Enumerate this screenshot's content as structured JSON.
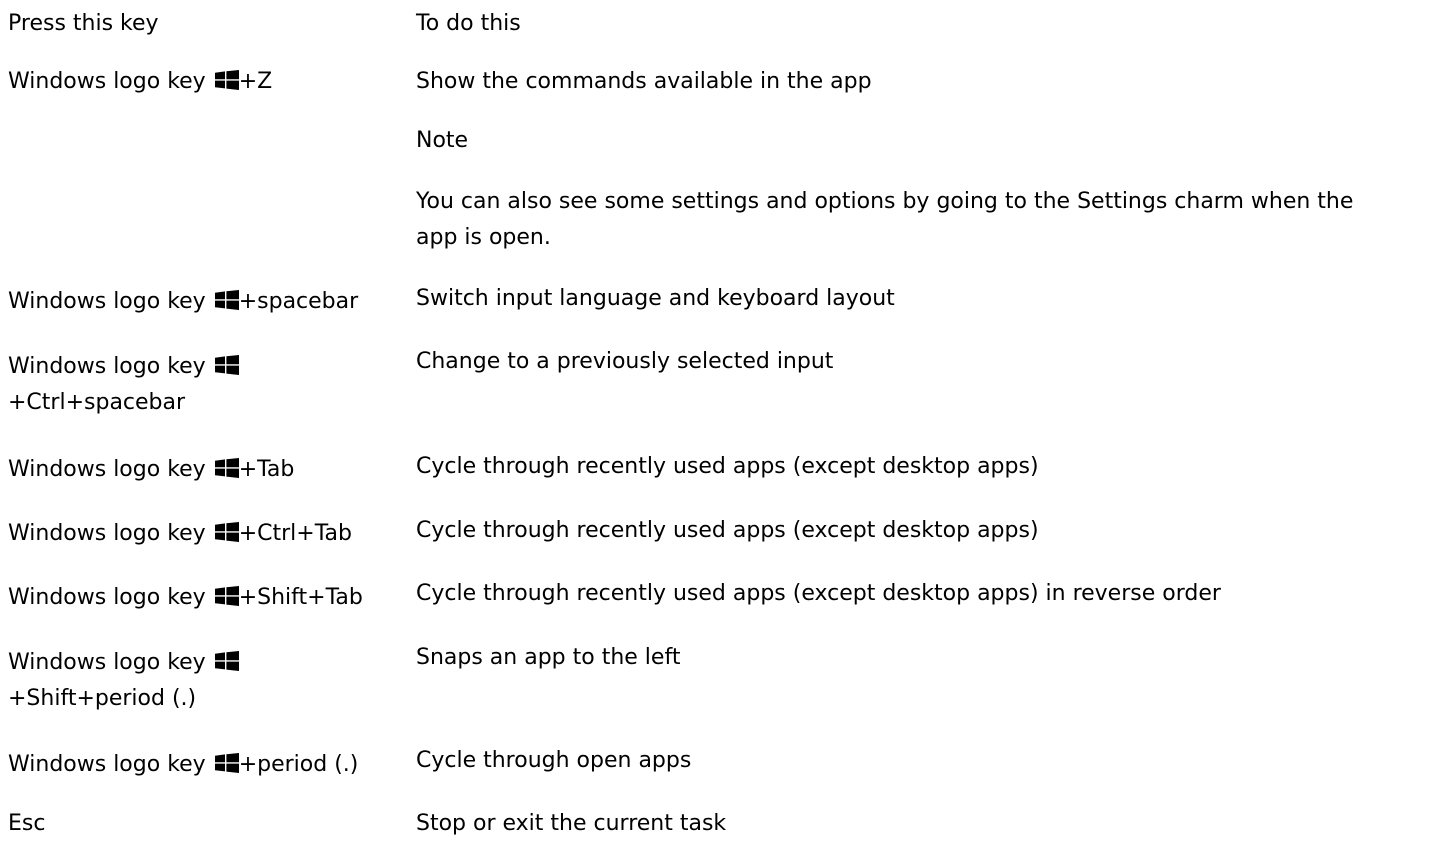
{
  "header": {
    "key": "Press this key",
    "action": "To do this"
  },
  "rows": [
    {
      "key_prefix": "Windows logo key",
      "key_suffix": "+Z",
      "action": "Show the commands available in the app"
    },
    {
      "note_label": "Note",
      "note_line1": "You can also see some settings and options by going to the Settings charm when the",
      "note_line2": "app is open."
    },
    {
      "key_prefix": "Windows logo key",
      "key_suffix": "+spacebar",
      "action": "Switch input language and keyboard layout"
    },
    {
      "key_prefix": "Windows logo key",
      "key_suffix": "+Ctrl+spacebar",
      "action": "Change to a previously selected input"
    },
    {
      "key_prefix": "Windows logo key",
      "key_suffix": "+Tab",
      "action": "Cycle through recently used apps (except desktop apps)"
    },
    {
      "key_prefix": "Windows logo key",
      "key_suffix": "+Ctrl+Tab",
      "action": "Cycle through recently used apps (except desktop apps)"
    },
    {
      "key_prefix": "Windows logo key",
      "key_suffix": "+Shift+Tab",
      "action": "Cycle through recently used apps (except desktop apps) in reverse order"
    },
    {
      "key_prefix": "Windows logo key",
      "key_suffix": "+Shift+period (.)",
      "action": "Snaps an app to the left"
    },
    {
      "key_prefix": "Windows logo key",
      "key_suffix": "+period (.)",
      "action": "Cycle through open apps"
    },
    {
      "key": "Esc",
      "action": "Stop or exit the current task"
    }
  ],
  "icons": {
    "windows_logo": "windows-logo-icon"
  }
}
